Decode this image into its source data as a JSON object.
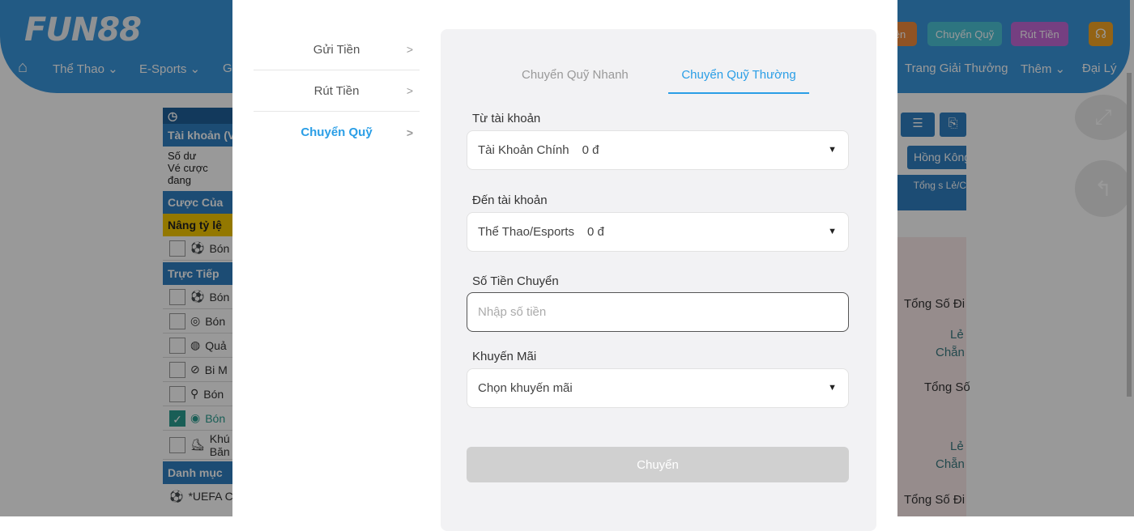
{
  "site": {
    "logo": "FUN88",
    "nav": [
      "Thể Thao",
      "E-Sports",
      "G",
      "Trang Giải Thưởng",
      "Thêm",
      "Đại Lý"
    ],
    "top_buttons": {
      "deposit": "ền",
      "transfer": "Chuyển Quỹ",
      "withdraw": "Rút Tiền"
    }
  },
  "sidebar": {
    "account": "Tài khoản (V",
    "balance": "Số dư",
    "tickets": "Vé cược đang",
    "my_bets": "Cược Của",
    "boost": "Nâng tỷ lệ",
    "live": "Trực Tiếp",
    "categories": "Danh mục",
    "uefa": "*UEFA C",
    "items": [
      "Bón",
      "Bón",
      "Bón",
      "Quả",
      "Bi M",
      "Bón",
      "Bón",
      "Khú Băn"
    ]
  },
  "right": {
    "hongkong": "Hồng Kông",
    "col": "Tổng s Lẻ/C",
    "rows": [
      "Tổng Số Đi",
      "Lẻ",
      "Chẵn",
      "Tổng Số",
      "Lẻ",
      "Chẵn",
      "Tổng Số Đi"
    ]
  },
  "modal": {
    "menu": [
      {
        "label": "Gửi Tiền"
      },
      {
        "label": "Rút Tiền"
      },
      {
        "label": "Chuyển Quỹ",
        "active": true
      }
    ],
    "tabs": [
      {
        "label": "Chuyển Quỹ Nhanh"
      },
      {
        "label": "Chuyển Quỹ Thường",
        "active": true
      }
    ],
    "from": {
      "label": "Từ tài khoản",
      "value": "Tài Khoản Chính",
      "amount": "0 đ"
    },
    "to": {
      "label": "Đến tài khoản",
      "value": "Thể Thao/Esports",
      "amount": "0 đ"
    },
    "amount": {
      "label": "Số Tiền Chuyển",
      "placeholder": "Nhập số tiền",
      "value": ""
    },
    "promo": {
      "label": "Khuyến Mãi",
      "value": "Chọn khuyến mãi"
    },
    "submit": "Chuyển"
  },
  "colors": {
    "accent": "#2a9ee6",
    "header": "#3a97dd",
    "disabled_button": "#d0d0d0"
  }
}
